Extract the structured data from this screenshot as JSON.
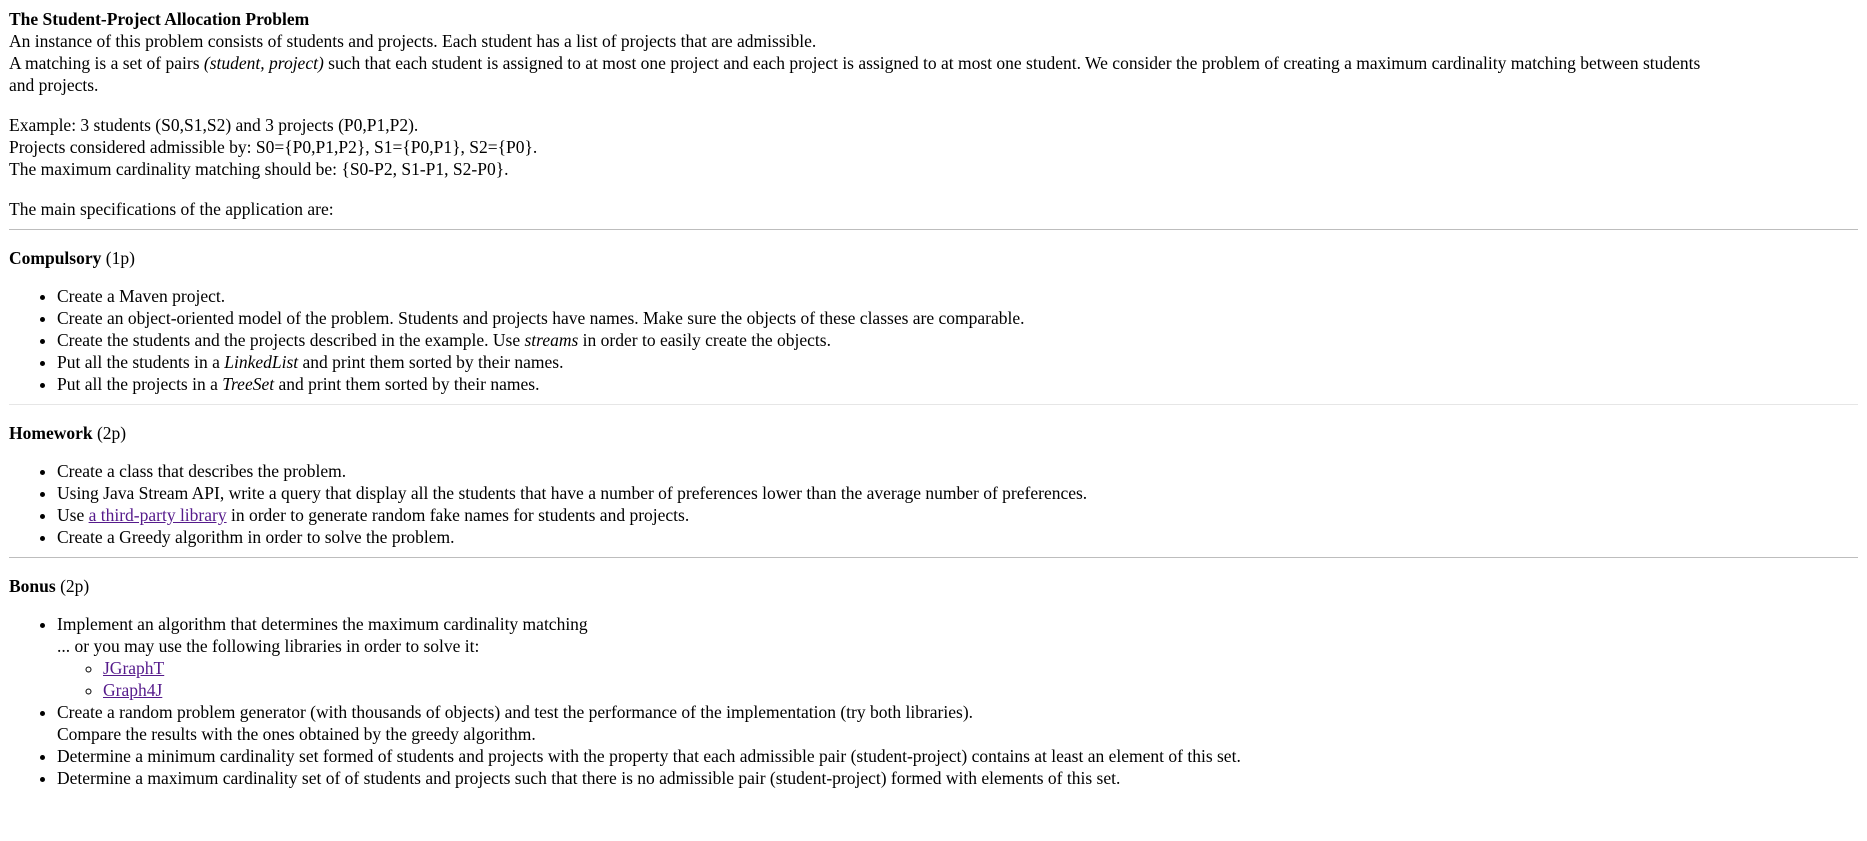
{
  "title": "The Student-Project Allocation Problem",
  "intro": {
    "line1": "An instance of this problem consists of students and projects. Each student has a list of projects that are admissible.",
    "line2_a": "A matching is a set of pairs ",
    "line2_em": "(student, project)",
    "line2_b": " such that each student is assigned to at most one project and each project is assigned to at most one student. We consider the problem of creating a maximum cardinality matching between students",
    "line3": "and projects."
  },
  "example": {
    "line1": "Example: 3 students (S0,S1,S2) and 3 projects (P0,P1,P2).",
    "line2": "Projects considered admissible by: S0={P0,P1,P2}, S1={P0,P1}, S2={P0}.",
    "line3": "The maximum cardinality matching should be: {S0-P2, S1-P1, S2-P0}."
  },
  "specs_intro": "The main specifications of the application are:",
  "compulsory": {
    "heading": "Compulsory",
    "points": "(1p)",
    "items": {
      "i0": "Create a Maven project.",
      "i1": "Create an object-oriented model of the problem. Students and projects have names. Make sure the objects of these classes are comparable.",
      "i2_a": "Create the students and the projects described in the example. Use ",
      "i2_em": "streams",
      "i2_b": " in order to easily create the objects.",
      "i3_a": "Put all the students in a ",
      "i3_em": "LinkedList",
      "i3_b": " and print them sorted by their names.",
      "i4_a": "Put all the projects in a ",
      "i4_em": "TreeSet",
      "i4_b": " and print them sorted by their names."
    }
  },
  "homework": {
    "heading": "Homework",
    "points": "(2p)",
    "items": {
      "i0": "Create a class that describes the problem.",
      "i1": "Using Java Stream API, write a query that display all the students that have a number of preferences lower than the average number of preferences.",
      "i2_a": "Use ",
      "i2_link": "a third-party library",
      "i2_b": " in order to generate random fake names for students and projects.",
      "i3": "Create a Greedy algorithm in order to solve the problem."
    }
  },
  "bonus": {
    "heading": "Bonus",
    "points": "(2p)",
    "items": {
      "i0_a": "Implement an algorithm that determines the maximum cardinality matching",
      "i0_b": "... or you may use the following libraries in order to solve it:",
      "lib1": "JGraphT",
      "lib2": "Graph4J",
      "i1_a": "Create a random problem generator (with thousands of objects) and test the performance of the implementation (try both libraries).",
      "i1_b": "Compare the results with the ones obtained by the greedy algorithm.",
      "i2": "Determine a minimum cardinality set formed of students and projects with the property that each admissible pair (student-project) contains at least an element of this set.",
      "i3": "Determine a maximum cardinality set of of students and projects such that there is no admissible pair (student-project) formed with elements of this set."
    }
  },
  "colors": {
    "link": "#551a8b",
    "rule": "#bdbdbd"
  }
}
